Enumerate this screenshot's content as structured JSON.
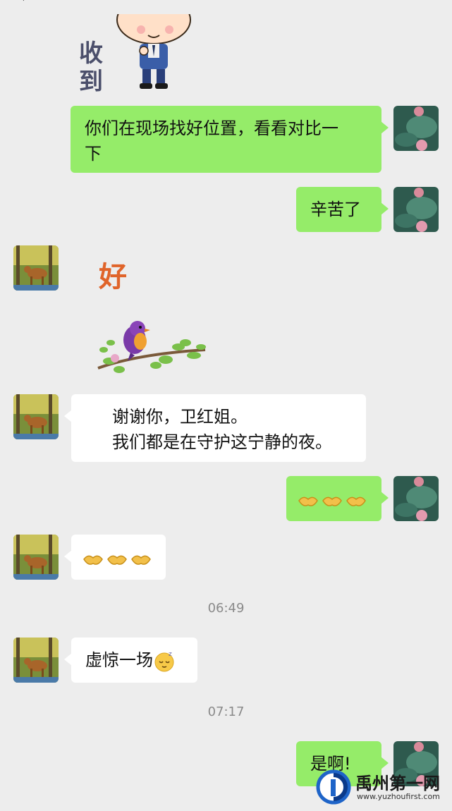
{
  "header": {
    "title": "",
    "back_glyph": "‹"
  },
  "stickers": {
    "received": {
      "text_1": "收",
      "text_2": "到"
    },
    "good": {
      "text": "好"
    }
  },
  "messages": {
    "m1": "你们在现场找好位置，看看对比一",
    "m1b": "下",
    "m2": "辛苦了",
    "m3a": "谢谢你，卫红姐。",
    "m3b": "我们都是在守护这宁静的夜。",
    "m6": "虚惊一场",
    "m7": "是啊!"
  },
  "timestamps": {
    "t1": "06:49",
    "t2": "07:17"
  },
  "emoji": {
    "handshake": "handshake-emoji",
    "sleepy": "sleepy-face-emoji"
  },
  "colors": {
    "sent_bubble": "#95ec69",
    "received_bubble": "#ffffff",
    "background": "#ededed",
    "timestamp": "#8a8a8a"
  },
  "watermark": {
    "name": "禹州第一网",
    "url": "www.yuzhoufirst.com"
  }
}
